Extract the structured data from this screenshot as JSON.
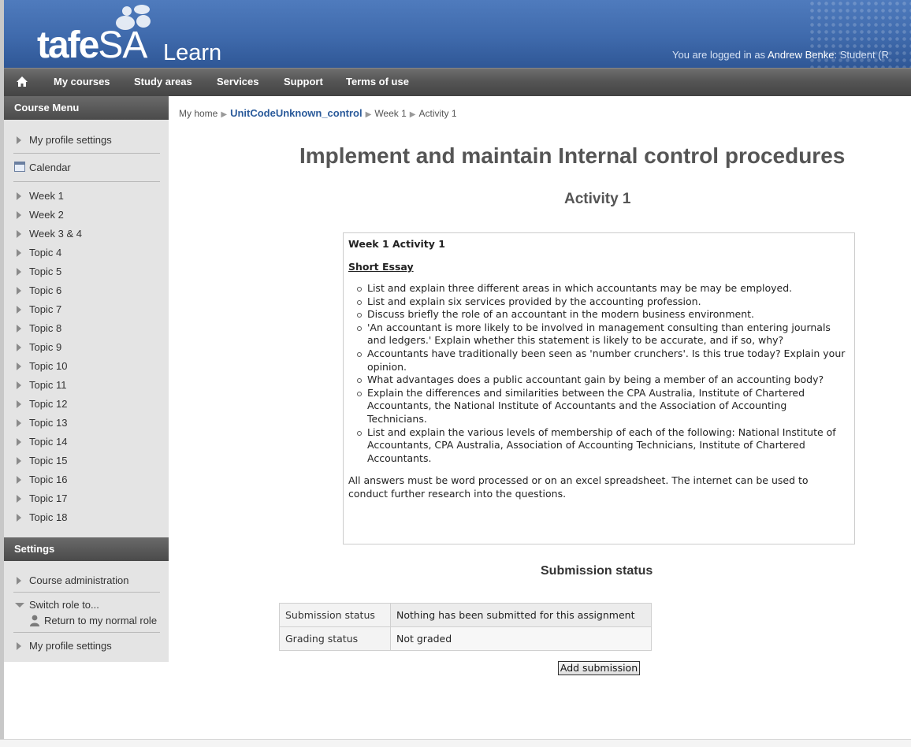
{
  "header": {
    "logo_main": "tafe",
    "logo_sa": "SA",
    "logo_learn": "Learn",
    "login_prefix": "You are logged in as ",
    "user_name": "Andrew Benke",
    "login_suffix": ": Student (R"
  },
  "nav": {
    "home_icon": "home-icon",
    "items": [
      "My courses",
      "Study areas",
      "Services",
      "Support",
      "Terms of use"
    ]
  },
  "course_menu": {
    "title": "Course Menu",
    "profile_settings": "My profile settings",
    "calendar": "Calendar",
    "weeks": [
      "Week 1",
      "Week 2",
      "Week 3 & 4",
      "Topic 4",
      "Topic 5",
      "Topic 6",
      "Topic 7",
      "Topic 8",
      "Topic 9",
      "Topic 10",
      "Topic 11",
      "Topic 12",
      "Topic 13",
      "Topic 14",
      "Topic 15",
      "Topic 16",
      "Topic 17",
      "Topic 18"
    ]
  },
  "settings": {
    "title": "Settings",
    "course_admin": "Course administration",
    "switch_role": "Switch role to...",
    "return_role": "Return to my normal role",
    "profile_settings": "My profile settings"
  },
  "breadcrumb": {
    "home": "My home",
    "course": "UnitCodeUnknown_control",
    "week": "Week 1",
    "activity": "Activity 1"
  },
  "page": {
    "title": "Implement and maintain Internal control procedures",
    "activity_title": "Activity 1"
  },
  "intro": {
    "heading": "Week 1 Activity 1",
    "subheading": "Short Essay",
    "bullets": [
      "List and explain three different areas in which accountants may be may be employed.",
      "List and explain six services provided by the accounting profession.",
      "Discuss briefly the role of an accountant in the modern business environment.",
      "'An accountant is more likely to be involved in management consulting than entering journals and ledgers.' Explain whether this statement is likely to be accurate, and if so, why?",
      "Accountants have traditionally been seen as 'number crunchers'. Is this true today? Explain your opinion.",
      "What advantages does a public accountant gain by being a member of an accounting body?",
      "Explain the differences and similarities between the CPA Australia, Institute of Chartered Accountants, the National Institute of Accountants and the Association of Accounting Technicians.",
      "List and explain the various levels of membership of each of the following: National Institute of Accountants, CPA Australia, Association of Accounting Technicians, Institute of Chartered Accountants."
    ],
    "footer": "All answers must be word processed or on an excel spreadsheet. The internet can be used to conduct further research into the questions."
  },
  "submission": {
    "heading": "Submission status",
    "rows": [
      {
        "label": "Submission status",
        "value": "Nothing has been submitted for this assignment"
      },
      {
        "label": "Grading status",
        "value": "Not graded"
      }
    ],
    "add_button": "Add submission"
  }
}
